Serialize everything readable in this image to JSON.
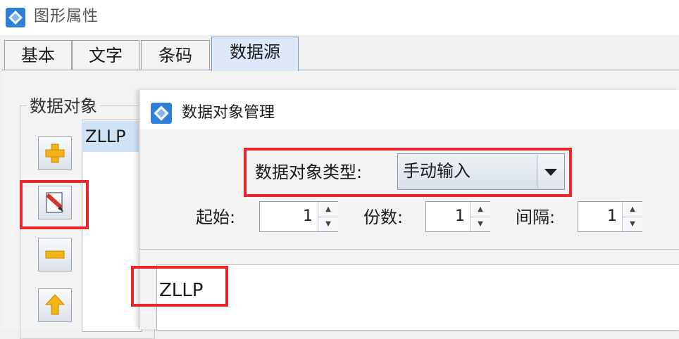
{
  "window": {
    "title": "图形属性"
  },
  "tabs": [
    {
      "label": "基本"
    },
    {
      "label": "文字"
    },
    {
      "label": "条码"
    },
    {
      "label": "数据源"
    }
  ],
  "data_object_group": {
    "label": "数据对象",
    "items": [
      "ZLLP"
    ],
    "buttons": [
      "add-icon",
      "edit-icon",
      "remove-icon",
      "move-up-icon"
    ]
  },
  "dialog": {
    "title": "数据对象管理",
    "type_label": "数据对象类型:",
    "type_value": "手动输入",
    "start_label": "起始:",
    "start_value": "1",
    "copies_label": "份数:",
    "copies_value": "1",
    "interval_label": "间隔:",
    "interval_value": "1",
    "text_value": "ZLLP"
  },
  "colors": {
    "highlight_box": "#e8262b",
    "active_tab": "#dbe9f8",
    "selected_item": "#cfe3f7"
  }
}
